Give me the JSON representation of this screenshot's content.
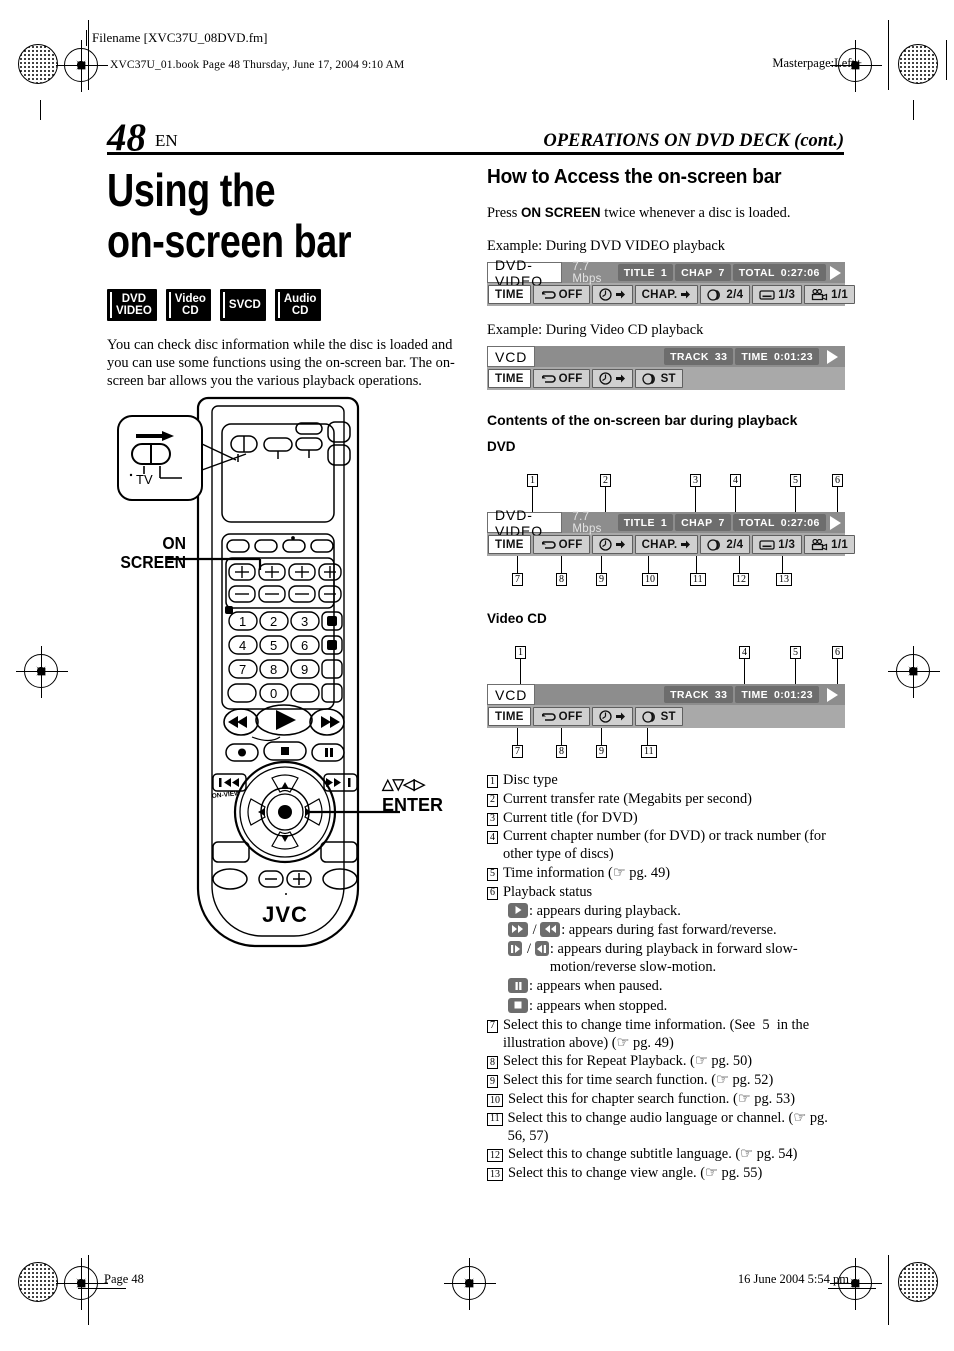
{
  "header": {
    "filename": "Filename [XVC37U_08DVD.fm]",
    "book_line": "XVC37U_01.book  Page 48  Thursday, June 17, 2004  9:10 AM",
    "masterpage": "Masterpage:Left+"
  },
  "footer": {
    "page": "Page 48",
    "date": "16 June 2004 5:54 pm"
  },
  "page_head": {
    "page_number": "48",
    "lang": "EN",
    "running_head": "OPERATIONS ON DVD DECK (cont.)"
  },
  "left": {
    "title_line1": "Using the",
    "title_line2": "on-screen bar",
    "badges": [
      {
        "line1": "DVD",
        "line2": "VIDEO"
      },
      {
        "line1": "Video",
        "line2": "CD"
      },
      {
        "line1": "SVCD",
        "line2": ""
      },
      {
        "line1": "Audio",
        "line2": "CD"
      }
    ],
    "intro": "You can check disc information while the disc is loaded and you can use some functions using the on-screen bar. The on-screen bar allows you the various playback operations.",
    "callout_onscreen": "ON\nSCREEN",
    "callout_onscreen_l1": "ON",
    "callout_onscreen_l2": "SCREEN",
    "callout_enter_arrows": "△▽◁▷",
    "callout_enter": "ENTER",
    "remote_brand": "JVC",
    "remote_tv_label": "TV",
    "keypad": [
      "1",
      "2",
      "3",
      "4",
      "5",
      "6",
      "7",
      "8",
      "9",
      "0"
    ]
  },
  "right": {
    "section_title": "How to Access the on-screen bar",
    "press_text_pre": "Press ",
    "press_text_bold": "ON SCREEN",
    "press_text_post": " twice whenever a disc is loaded.",
    "example_dvd_label": "Example: During DVD VIDEO playback",
    "example_vcd_label": "Example: During Video CD playback",
    "contents_title": "Contents of the on-screen bar during playback",
    "dvd_label": "DVD",
    "videocd_label": "Video CD"
  },
  "osd_dvd": {
    "disc_type": "DVD-VIDEO",
    "rate": "7.7 Mbps",
    "chips": [
      {
        "label": "TITLE",
        "value": "1"
      },
      {
        "label": "CHAP",
        "value": "7"
      },
      {
        "label": "TOTAL",
        "value": "0:27:06"
      }
    ],
    "play_status": "play-icon",
    "buttons": [
      {
        "icon": "",
        "label": "TIME",
        "name": "time-button"
      },
      {
        "icon": "repeat-icon",
        "label": "OFF",
        "name": "repeat-button"
      },
      {
        "icon": "clock-icon",
        "label": "",
        "name": "time-search-button"
      },
      {
        "icon": "",
        "label": "CHAP.",
        "name": "chapter-search-button"
      },
      {
        "icon": "audio-icon",
        "label": "2/4",
        "name": "audio-button"
      },
      {
        "icon": "subtitle-icon",
        "label": "1/3",
        "name": "subtitle-button"
      },
      {
        "icon": "angle-icon",
        "label": "1/1",
        "name": "angle-button"
      }
    ]
  },
  "osd_vcd": {
    "disc_type": "VCD",
    "rate": "",
    "chips": [
      {
        "label": "TRACK",
        "value": "33"
      },
      {
        "label": "TIME",
        "value": "0:01:23"
      }
    ],
    "play_status": "play-icon",
    "buttons": [
      {
        "icon": "",
        "label": "TIME",
        "name": "time-button"
      },
      {
        "icon": "repeat-icon",
        "label": "OFF",
        "name": "repeat-button"
      },
      {
        "icon": "clock-icon",
        "label": "",
        "name": "time-search-button"
      },
      {
        "icon": "audio-icon",
        "label": "ST",
        "name": "audio-button"
      }
    ]
  },
  "callouts_dvd": {
    "top": [
      "1",
      "2",
      "3",
      "4",
      "5",
      "6"
    ],
    "bottom": [
      "7",
      "8",
      "9",
      "10",
      "11",
      "12",
      "13"
    ]
  },
  "callouts_vcd": {
    "top": [
      "1",
      "4",
      "5",
      "6"
    ],
    "bottom": [
      "7",
      "8",
      "9",
      "11"
    ]
  },
  "legend": [
    {
      "num": "1",
      "text": "Disc type"
    },
    {
      "num": "2",
      "text": "Current transfer rate (Megabits per second)"
    },
    {
      "num": "3",
      "text": "Current title (for DVD)"
    },
    {
      "num": "4",
      "text": "Current chapter number (for DVD) or track number (for other type of discs)"
    },
    {
      "num": "5",
      "text": "Time information (☞ pg. 49)"
    },
    {
      "num": "6",
      "text": "Playback status"
    },
    {
      "num": "7",
      "text": "Select this to change time information. (See  5  in the illustration above) (☞ pg. 49)"
    },
    {
      "num": "8",
      "text": "Select this for Repeat Playback. (☞ pg. 50)"
    },
    {
      "num": "9",
      "text": "Select this for time search function. (☞ pg. 52)"
    },
    {
      "num": "10",
      "text": "Select this for chapter search function. (☞ pg. 53)"
    },
    {
      "num": "11",
      "text": "Select this to change audio language or channel. (☞ pg. 56, 57)"
    },
    {
      "num": "12",
      "text": "Select this to change subtitle language. (☞ pg. 54)"
    },
    {
      "num": "13",
      "text": "Select this to change view angle. (☞ pg. 55)"
    }
  ],
  "playback_status_lines": [
    {
      "icons": [
        "play"
      ],
      "text": ": appears during playback."
    },
    {
      "icons": [
        "ffwd",
        "frev"
      ],
      "text": ": appears during fast forward/reverse."
    },
    {
      "icons": [
        "slowfwd",
        "slowrev"
      ],
      "text": ": appears during playback in forward slow-motion/reverse slow-motion."
    },
    {
      "icons": [
        "pause"
      ],
      "text": ": appears when paused."
    },
    {
      "icons": [
        "stop"
      ],
      "text": ": appears when stopped."
    }
  ],
  "colors": {
    "osd_top_bg": "#8d8d8d",
    "osd_bottom_bg": "#a9a9a9",
    "osd_chip_bg": "#6d6d6d",
    "osd_button_bg": "#d0d0d0",
    "badge_bg": "#000000",
    "text": "#000000"
  }
}
